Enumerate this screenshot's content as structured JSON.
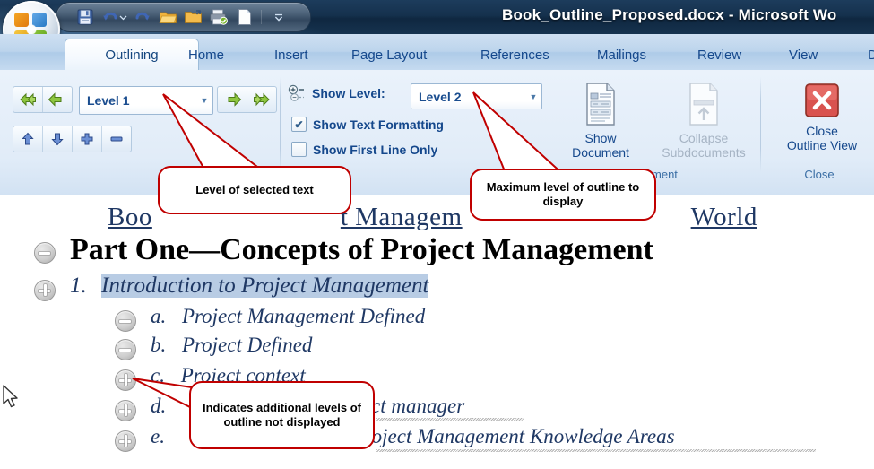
{
  "window": {
    "title": "Book_Outline_Proposed.docx - Microsoft Wo",
    "quick_access": [
      {
        "name": "save-icon",
        "label": "Save"
      },
      {
        "name": "undo-icon",
        "label": "Undo"
      },
      {
        "name": "undo-dropdown-icon",
        "label": "Undo options"
      },
      {
        "name": "redo-icon",
        "label": "Redo"
      },
      {
        "name": "open-icon",
        "label": "Open"
      },
      {
        "name": "new-folder-icon",
        "label": "Folder"
      },
      {
        "name": "print-icon",
        "label": "Quick Print"
      },
      {
        "name": "new-document-icon",
        "label": "New"
      },
      {
        "name": "customize-qat-icon",
        "label": "Customize Quick Access Toolbar"
      }
    ],
    "office_button_label": "Office Button"
  },
  "tabs": [
    {
      "label": "Outlining",
      "active": true
    },
    {
      "label": "Home",
      "active": false
    },
    {
      "label": "Insert",
      "active": false
    },
    {
      "label": "Page Layout",
      "active": false
    },
    {
      "label": "References",
      "active": false
    },
    {
      "label": "Mailings",
      "active": false
    },
    {
      "label": "Review",
      "active": false
    },
    {
      "label": "View",
      "active": false
    },
    {
      "label": "D",
      "active": false
    }
  ],
  "ribbon": {
    "groups": [
      {
        "name": "outline-tools",
        "label": ""
      },
      {
        "name": "master-document",
        "label": "ocument"
      },
      {
        "name": "close",
        "label": "Close"
      }
    ],
    "outline_tools": {
      "promote_to_heading1": "Promote to Heading 1",
      "promote": "Promote",
      "level_value": "Level 1",
      "level_caret": "▼",
      "demote": "Demote",
      "demote_to_body": "Demote to Body Text",
      "move_up": "Move Up",
      "move_down": "Move Down",
      "expand": "Expand",
      "collapse": "Collapse"
    },
    "show_level": {
      "icon_label": "show-level-icon",
      "label": "Show Level:",
      "value": "Level 2",
      "caret": "▼"
    },
    "checkboxes": [
      {
        "label": "Show Text Formatting",
        "checked": true,
        "mark": "✔"
      },
      {
        "label": "Show First Line Only",
        "checked": false,
        "mark": ""
      }
    ],
    "master_document": {
      "show_document": {
        "line1": "Show",
        "line2": "Document",
        "disabled": false
      },
      "collapse_subdocuments": {
        "line1": "Collapse",
        "line2": "Subdocuments",
        "disabled": true
      }
    },
    "close_group": {
      "close_outline_view": {
        "line1": "Close",
        "line2": "Outline View"
      }
    }
  },
  "document": {
    "heading_line": {
      "before": "Boo",
      "middle": "t Managem",
      "after": "World"
    },
    "part_heading": "Part One—Concepts of Project Management",
    "outline_items": [
      {
        "marker": "minus",
        "number": "",
        "text": "",
        "level": 0
      },
      {
        "marker": "plus",
        "number": "1.",
        "text": "Introduction to Project Management",
        "level": 1,
        "selected": true
      },
      {
        "marker": "minus",
        "number": "a.",
        "text": "Project Management Defined",
        "level": 2,
        "selected": false
      },
      {
        "marker": "minus",
        "number": "b.",
        "text": "Project  Defined",
        "level": 2,
        "selected": false
      },
      {
        "marker": "plus",
        "number": "c.",
        "text": "Project context",
        "level": 2,
        "selected": false
      },
      {
        "marker": "plus",
        "number": "d.",
        "text": "project manager",
        "level": 2,
        "selected": false
      },
      {
        "marker": "plus",
        "number": "e.",
        "text": "he Project Management Knowledge Areas",
        "level": 2,
        "selected": false
      }
    ]
  },
  "callouts": [
    {
      "name": "callout-level-of-selected-text",
      "text": "Level of selected text"
    },
    {
      "name": "callout-maximum-level",
      "text": "Maximum level of outline to display"
    },
    {
      "name": "callout-additional-levels",
      "text": "Indicates additional levels of outline not displayed"
    }
  ],
  "colors": {
    "callout_border": "#c00000",
    "title_bar": "#15314d",
    "tab_text": "#15488c",
    "doc_heading": "#1f3864",
    "selection": "#b8cce4",
    "close_red": "#c0392b"
  }
}
